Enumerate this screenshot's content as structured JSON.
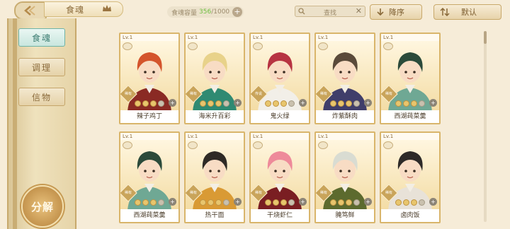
{
  "header": {
    "title": "食魂",
    "capacity_label": "食魂容量",
    "capacity_current": "356",
    "capacity_max": "/1000",
    "search_placeholder": "查找",
    "sort_label": "降序",
    "filter_label": "默认"
  },
  "sidebar": {
    "items": [
      {
        "label": "食魂",
        "active": true
      },
      {
        "label": "调理",
        "active": false
      },
      {
        "label": "信物",
        "active": false
      }
    ],
    "decompose_label": "分解"
  },
  "cards": [
    {
      "level": "Lv.1",
      "name": "辣子鸡丁",
      "rarity": "稀有",
      "hair": "#d4542c",
      "cloth": "#8a2a24",
      "filled": 3
    },
    {
      "level": "Lv.1",
      "name": "海米升百彩",
      "rarity": "稀有",
      "hair": "#e8d28a",
      "cloth": "#2f8a72",
      "filled": 3
    },
    {
      "level": "Lv.1",
      "name": "鬼火绿",
      "rarity": "传说",
      "hair": "#b73342",
      "cloth": "#f2efe8",
      "filled": 3
    },
    {
      "level": "Lv.1",
      "name": "炸紫酥肉",
      "rarity": "稀有",
      "hair": "#5a4a3a",
      "cloth": "#403e6a",
      "filled": 3
    },
    {
      "level": "Lv.1",
      "name": "西湖莼菜羹",
      "rarity": "稀有",
      "hair": "#2b4a3a",
      "cloth": "#6fa894",
      "filled": 3
    },
    {
      "level": "Lv.1",
      "name": "西湖莼菜羹",
      "rarity": "稀有",
      "hair": "#2b4a3a",
      "cloth": "#6fa894",
      "filled": 3
    },
    {
      "level": "Lv.1",
      "name": "热干面",
      "rarity": "稀有",
      "hair": "#2e2a25",
      "cloth": "#d99a34",
      "filled": 3
    },
    {
      "level": "Lv.1",
      "name": "干烧虾仁",
      "rarity": "稀有",
      "hair": "#ee8a9a",
      "cloth": "#7a1e22",
      "filled": 3
    },
    {
      "level": "Lv.1",
      "name": "腌笃鲜",
      "rarity": "稀有",
      "hair": "#d9dcd2",
      "cloth": "#5c6a2e",
      "filled": 3
    },
    {
      "level": "Lv.1",
      "name": "卤肉饭",
      "rarity": "稀有",
      "hair": "#2d2a28",
      "cloth": "#e8e2d8",
      "filled": 3
    }
  ],
  "colors": {
    "accent": "#c9a45a",
    "active_tab": "#6fb3a6"
  }
}
